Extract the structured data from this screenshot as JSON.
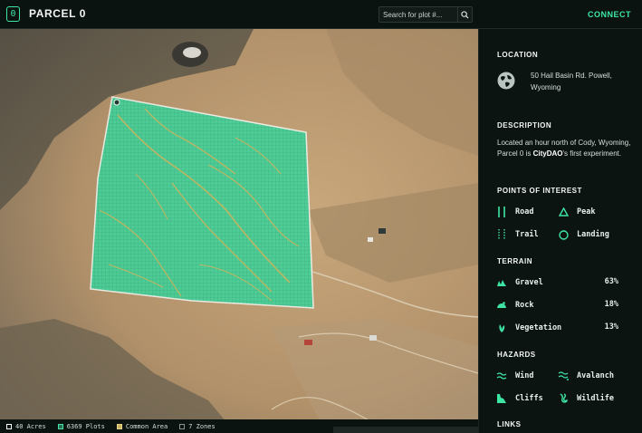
{
  "header": {
    "title": "PARCEL 0",
    "logo_glyph": "0",
    "search_placeholder": "Search for plot #...",
    "connect_label": "CONNECT"
  },
  "colors": {
    "accent": "#3ee6a5",
    "parcel_fill": "#45e3a6",
    "common_area": "#c8b35f",
    "background": "#0c1412"
  },
  "map": {
    "footer": {
      "acres": "40 Acres",
      "plots": "6369 Plots",
      "common": "Common Area",
      "zones": "7 Zones"
    }
  },
  "sidebar": {
    "location": {
      "title": "LOCATION",
      "address": "50 Hail Basin Rd. Powell, Wyoming",
      "icon": "globe-icon"
    },
    "description": {
      "title": "DESCRIPTION",
      "text_before": "Located an hour north of Cody, Wyoming, Parcel 0 is ",
      "text_bold": "CityDAO",
      "text_after": "'s first experiment."
    },
    "poi": {
      "title": "POINTS OF INTEREST",
      "items": [
        {
          "label": "Road",
          "icon": "road-icon"
        },
        {
          "label": "Peak",
          "icon": "peak-icon"
        },
        {
          "label": "Trail",
          "icon": "trail-icon"
        },
        {
          "label": "Landing",
          "icon": "landing-icon"
        }
      ]
    },
    "terrain": {
      "title": "TERRAIN",
      "items": [
        {
          "label": "Gravel",
          "pct": "63%",
          "icon": "gravel-icon"
        },
        {
          "label": "Rock",
          "pct": "18%",
          "icon": "rock-icon"
        },
        {
          "label": "Vegetation",
          "pct": "13%",
          "icon": "vegetation-icon"
        }
      ]
    },
    "hazards": {
      "title": "HAZARDS",
      "items": [
        {
          "label": "Wind",
          "icon": "wind-icon"
        },
        {
          "label": "Avalanch",
          "icon": "avalanche-icon"
        },
        {
          "label": "Cliffs",
          "icon": "cliffs-icon"
        },
        {
          "label": "Wildlife",
          "icon": "wildlife-icon"
        }
      ]
    },
    "links": {
      "title": "LINKS"
    }
  }
}
